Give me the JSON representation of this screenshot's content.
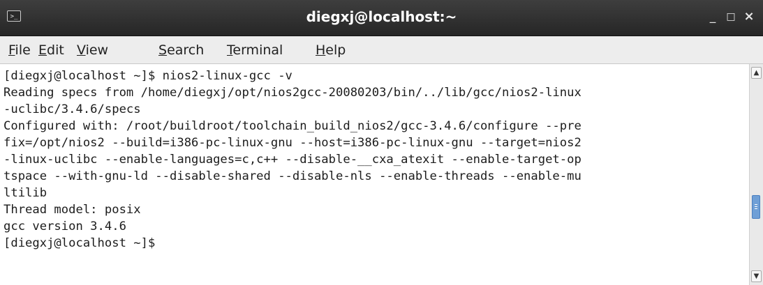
{
  "window": {
    "title": "diegxj@localhost:~",
    "terminal_icon": ">_",
    "minimize_glyph": "_",
    "maximize_glyph": "□",
    "close_glyph": "×"
  },
  "menu": {
    "items": [
      {
        "key": "F",
        "rest": "ile"
      },
      {
        "key": "E",
        "rest": "dit"
      },
      {
        "key": "V",
        "rest": "iew"
      },
      {
        "key": "S",
        "rest": "earch"
      },
      {
        "key": "T",
        "rest": "erminal"
      },
      {
        "key": "H",
        "rest": "elp"
      }
    ]
  },
  "terminal": {
    "lines": [
      "[diegxj@localhost ~]$ nios2-linux-gcc -v",
      "Reading specs from /home/diegxj/opt/nios2gcc-20080203/bin/../lib/gcc/nios2-linux",
      "-uclibc/3.4.6/specs",
      "Configured with: /root/buildroot/toolchain_build_nios2/gcc-3.4.6/configure --pre",
      "fix=/opt/nios2 --build=i386-pc-linux-gnu --host=i386-pc-linux-gnu --target=nios2",
      "-linux-uclibc --enable-languages=c,c++ --disable-__cxa_atexit --enable-target-op",
      "tspace --with-gnu-ld --disable-shared --disable-nls --enable-threads --enable-mu",
      "ltilib",
      "Thread model: posix",
      "gcc version 3.4.6",
      "[diegxj@localhost ~]$"
    ]
  },
  "scrollbar": {
    "up_arrow": "▲",
    "down_arrow": "▼",
    "thumb_color": "#6f9fd6"
  }
}
